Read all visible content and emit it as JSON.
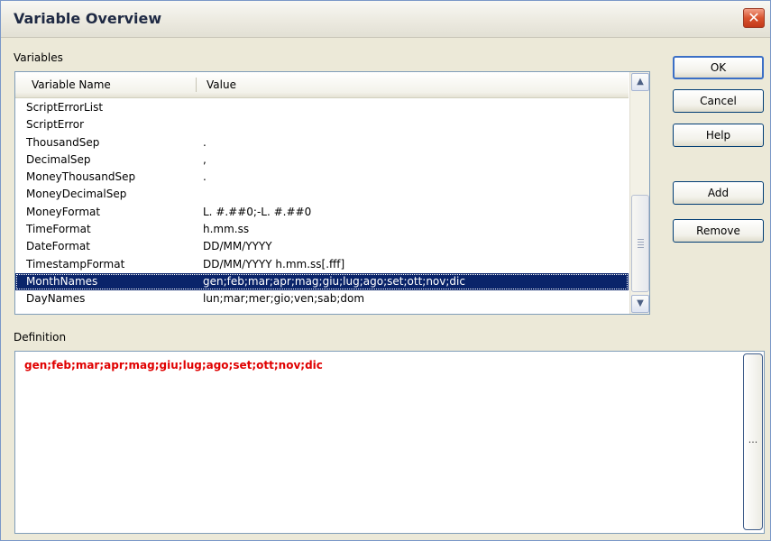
{
  "window": {
    "title": "Variable Overview",
    "close_label": "✕"
  },
  "variables_group": {
    "label": "Variables",
    "columns": [
      "Variable Name",
      "Value"
    ],
    "rows": [
      {
        "name": "ScriptErrorList",
        "value": ""
      },
      {
        "name": "ScriptError",
        "value": ""
      },
      {
        "name": "ThousandSep",
        "value": "."
      },
      {
        "name": "DecimalSep",
        "value": ","
      },
      {
        "name": "MoneyThousandSep",
        "value": "."
      },
      {
        "name": "MoneyDecimalSep",
        "value": ""
      },
      {
        "name": "MoneyFormat",
        "value": "L. #.##0;-L. #.##0"
      },
      {
        "name": "TimeFormat",
        "value": "h.mm.ss"
      },
      {
        "name": "DateFormat",
        "value": "DD/MM/YYYY"
      },
      {
        "name": "TimestampFormat",
        "value": "DD/MM/YYYY h.mm.ss[.fff]"
      },
      {
        "name": "MonthNames",
        "value": "gen;feb;mar;apr;mag;giu;lug;ago;set;ott;nov;dic",
        "selected": true
      },
      {
        "name": "DayNames",
        "value": "lun;mar;mer;gio;ven;sab;dom"
      }
    ],
    "scroll_up": "▲",
    "scroll_down": "▼"
  },
  "buttons": {
    "ok": "OK",
    "cancel": "Cancel",
    "help": "Help",
    "add": "Add",
    "remove": "Remove"
  },
  "definition": {
    "label": "Definition",
    "text": "gen;feb;mar;apr;mag;giu;lug;ago;set;ott;nov;dic",
    "text_color": "#e00000",
    "ellipsis": "..."
  },
  "colors": {
    "selection": "#0a246a",
    "dialog_bg": "#ece9d8"
  }
}
